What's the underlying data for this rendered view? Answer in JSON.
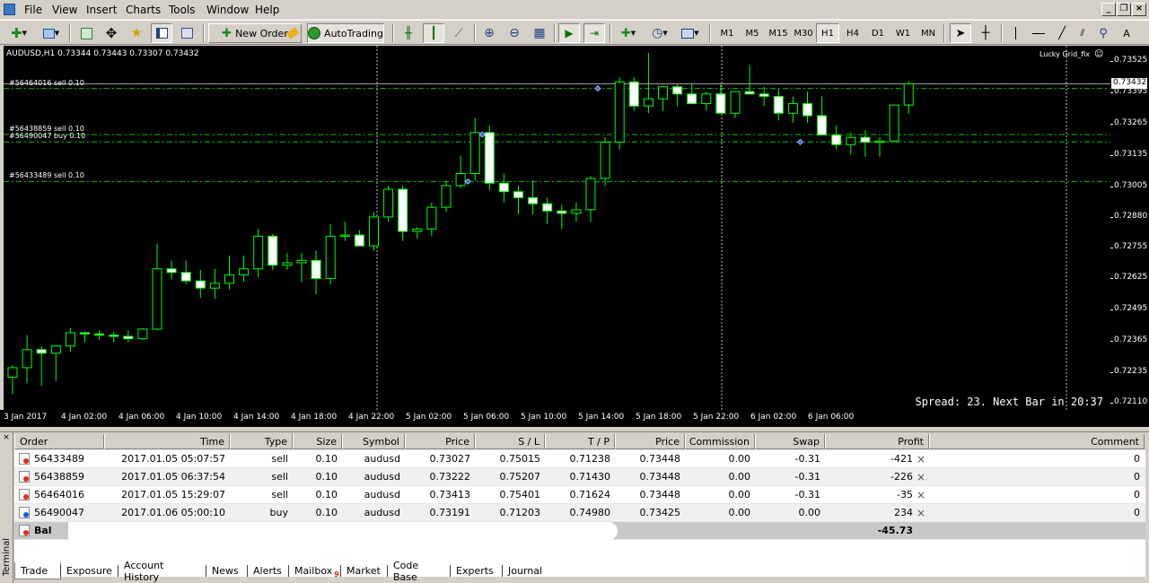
{
  "menu": {
    "items": [
      "File",
      "Edit",
      "View",
      "Insert",
      "Charts",
      "Tools",
      "Window",
      "Help"
    ],
    "file": "File",
    "view": "View",
    "insert": "Insert",
    "charts": "Charts",
    "tools": "Tools",
    "window": "Window",
    "help": "Help"
  },
  "toolbar": {
    "new_order": "New Order",
    "autotrading": "AutoTrading",
    "timeframes": [
      "M1",
      "M5",
      "M15",
      "M30",
      "H1",
      "H4",
      "D1",
      "W1",
      "MN"
    ],
    "active_timeframe": "H1"
  },
  "chart": {
    "header": "AUDUSD,H1  0.73344 0.73443 0.73307 0.73432",
    "expert": "Lucky Grid_fix",
    "spread_text": "Spread: 23. Next Bar in 20:37",
    "current_price": "0.73432",
    "price_ticks": [
      "0.73525",
      "0.73395",
      "0.73265",
      "0.73135",
      "0.73005",
      "0.72880",
      "0.72755",
      "0.72625",
      "0.72495",
      "0.72365",
      "0.72235",
      "0.72110"
    ],
    "time_ticks": [
      "3 Jan 2017",
      "4 Jan 02:00",
      "4 Jan 06:00",
      "4 Jan 10:00",
      "4 Jan 14:00",
      "4 Jan 18:00",
      "4 Jan 22:00",
      "5 Jan 02:00",
      "5 Jan 06:00",
      "5 Jan 10:00",
      "5 Jan 14:00",
      "5 Jan 18:00",
      "5 Jan 22:00",
      "6 Jan 02:00",
      "6 Jan 06:00"
    ],
    "order_lines": [
      {
        "label": "#56464016 sell 0.10",
        "price": 0.73413
      },
      {
        "label": "#56438859 sell 0.10",
        "price": 0.73222
      },
      {
        "label": "#56490047 buy 0.10",
        "price": 0.73191
      },
      {
        "label": "#56433489 sell 0.10",
        "price": 0.73027
      }
    ],
    "colors": {
      "bull": "#ffffff",
      "bear": "#ffffff",
      "wick": "#00ff00",
      "order_line": "#00c000",
      "background": "#000000"
    }
  },
  "terminal": {
    "side_label": "Terminal",
    "columns": [
      "Order",
      "Time",
      "Type",
      "Size",
      "Symbol",
      "Price",
      "S / L",
      "T / P",
      "Price",
      "Commission",
      "Swap",
      "Profit",
      "Comment"
    ],
    "rows": [
      {
        "order": "56433489",
        "time": "2017.01.05 05:07:57",
        "type": "sell",
        "size": "0.10",
        "symbol": "audusd",
        "price": "0.73027",
        "sl": "0.75015",
        "tp": "0.71238",
        "cur": "0.73448",
        "commission": "0.00",
        "swap": "-0.31",
        "profit": "-421",
        "comment": "0"
      },
      {
        "order": "56438859",
        "time": "2017.01.05 06:37:54",
        "type": "sell",
        "size": "0.10",
        "symbol": "audusd",
        "price": "0.73222",
        "sl": "0.75207",
        "tp": "0.71430",
        "cur": "0.73448",
        "commission": "0.00",
        "swap": "-0.31",
        "profit": "-226",
        "comment": "0"
      },
      {
        "order": "56464016",
        "time": "2017.01.05 15:29:07",
        "type": "sell",
        "size": "0.10",
        "symbol": "audusd",
        "price": "0.73413",
        "sl": "0.75401",
        "tp": "0.71624",
        "cur": "0.73448",
        "commission": "0.00",
        "swap": "-0.31",
        "profit": "-35",
        "comment": "0"
      },
      {
        "order": "56490047",
        "time": "2017.01.06 05:00:10",
        "type": "buy",
        "size": "0.10",
        "symbol": "audusd",
        "price": "0.73191",
        "sl": "0.71203",
        "tp": "0.74980",
        "cur": "0.73425",
        "commission": "0.00",
        "swap": "0.00",
        "profit": "234",
        "comment": "0"
      }
    ],
    "balance_label": "Bal",
    "total_profit": "-45.73",
    "tabs": [
      "Trade",
      "Exposure",
      "Account History",
      "News",
      "Alerts",
      "Mailbox",
      "Market",
      "Code Base",
      "Experts",
      "Journal"
    ],
    "mailbox_badge": "9",
    "active_tab": "Trade"
  }
}
